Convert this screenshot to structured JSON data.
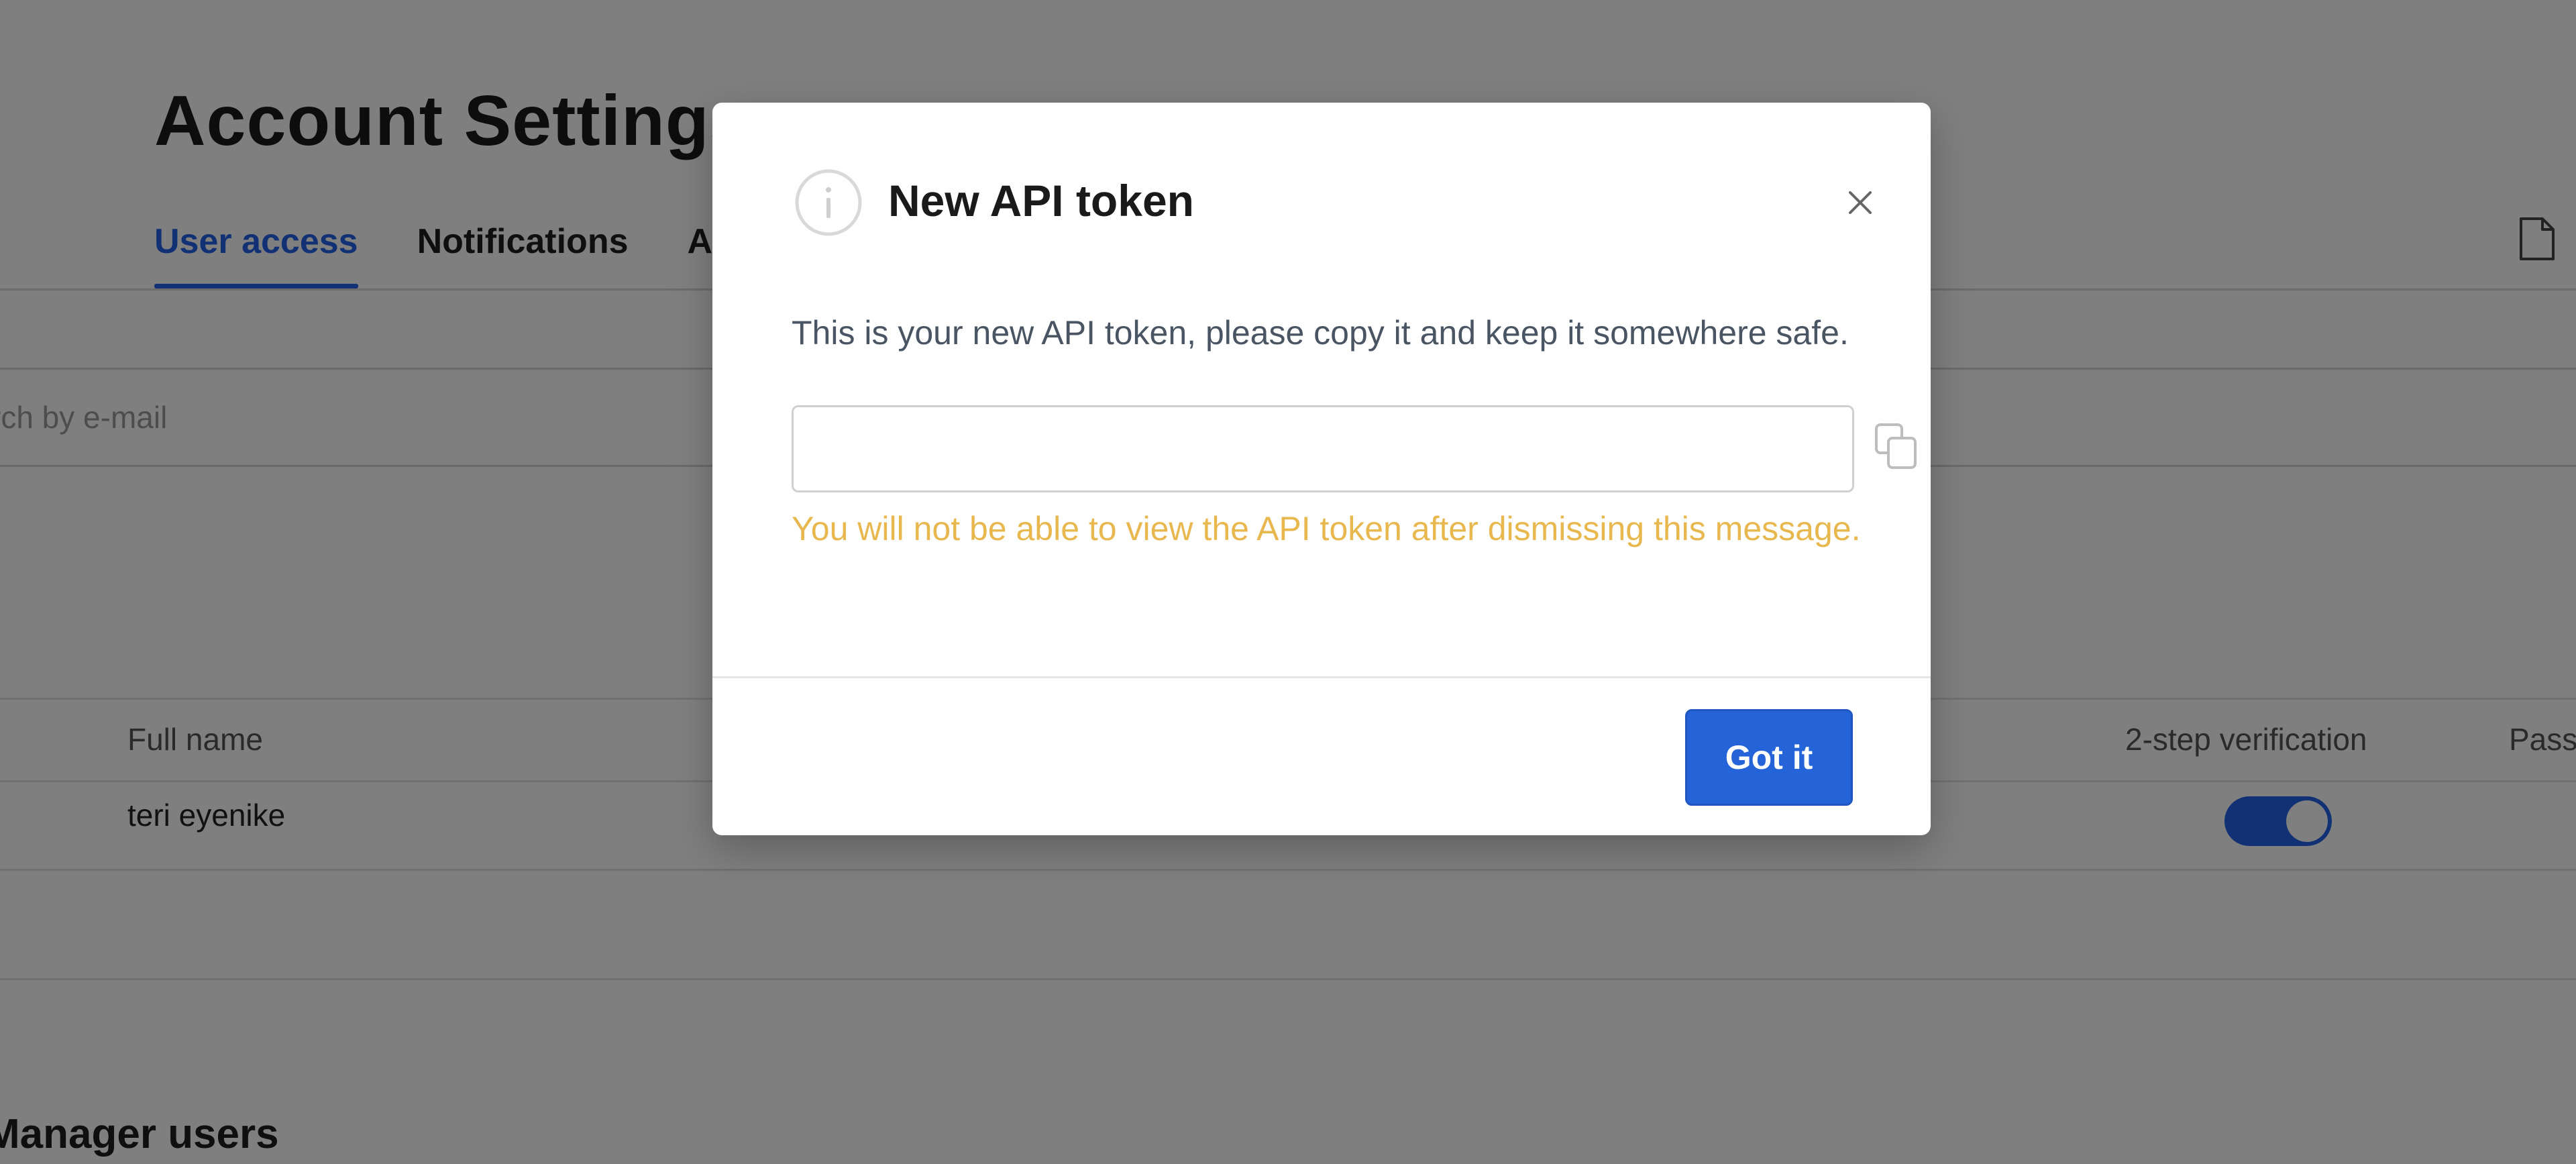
{
  "page": {
    "title": "Account Settings",
    "tabs": [
      {
        "label": "User access",
        "active": true
      },
      {
        "label": "Notifications",
        "active": false
      },
      {
        "label": "Ac",
        "active": false
      }
    ],
    "search": {
      "placeholder": "rch by e-mail"
    },
    "table": {
      "headers": {
        "full_name": "Full name",
        "two_step": "2-step verification",
        "password": "Pass"
      },
      "rows": [
        {
          "full_name": "teri eyenike",
          "two_step_enabled": true
        }
      ]
    },
    "section_title": "Manager users"
  },
  "modal": {
    "title": "New API token",
    "description": "This is your new API token, please copy it and keep it somewhere safe.",
    "token_value": "",
    "warning": "You will not be able to view the API token after dismissing this message.",
    "confirm_label": "Got it",
    "icons": {
      "info": "info-icon",
      "close": "close-icon",
      "copy": "copy-icon"
    }
  },
  "colors": {
    "accent": "#2563eb",
    "warning": "#e8b84f",
    "overlay": "rgba(0,0,0,0.5)"
  }
}
